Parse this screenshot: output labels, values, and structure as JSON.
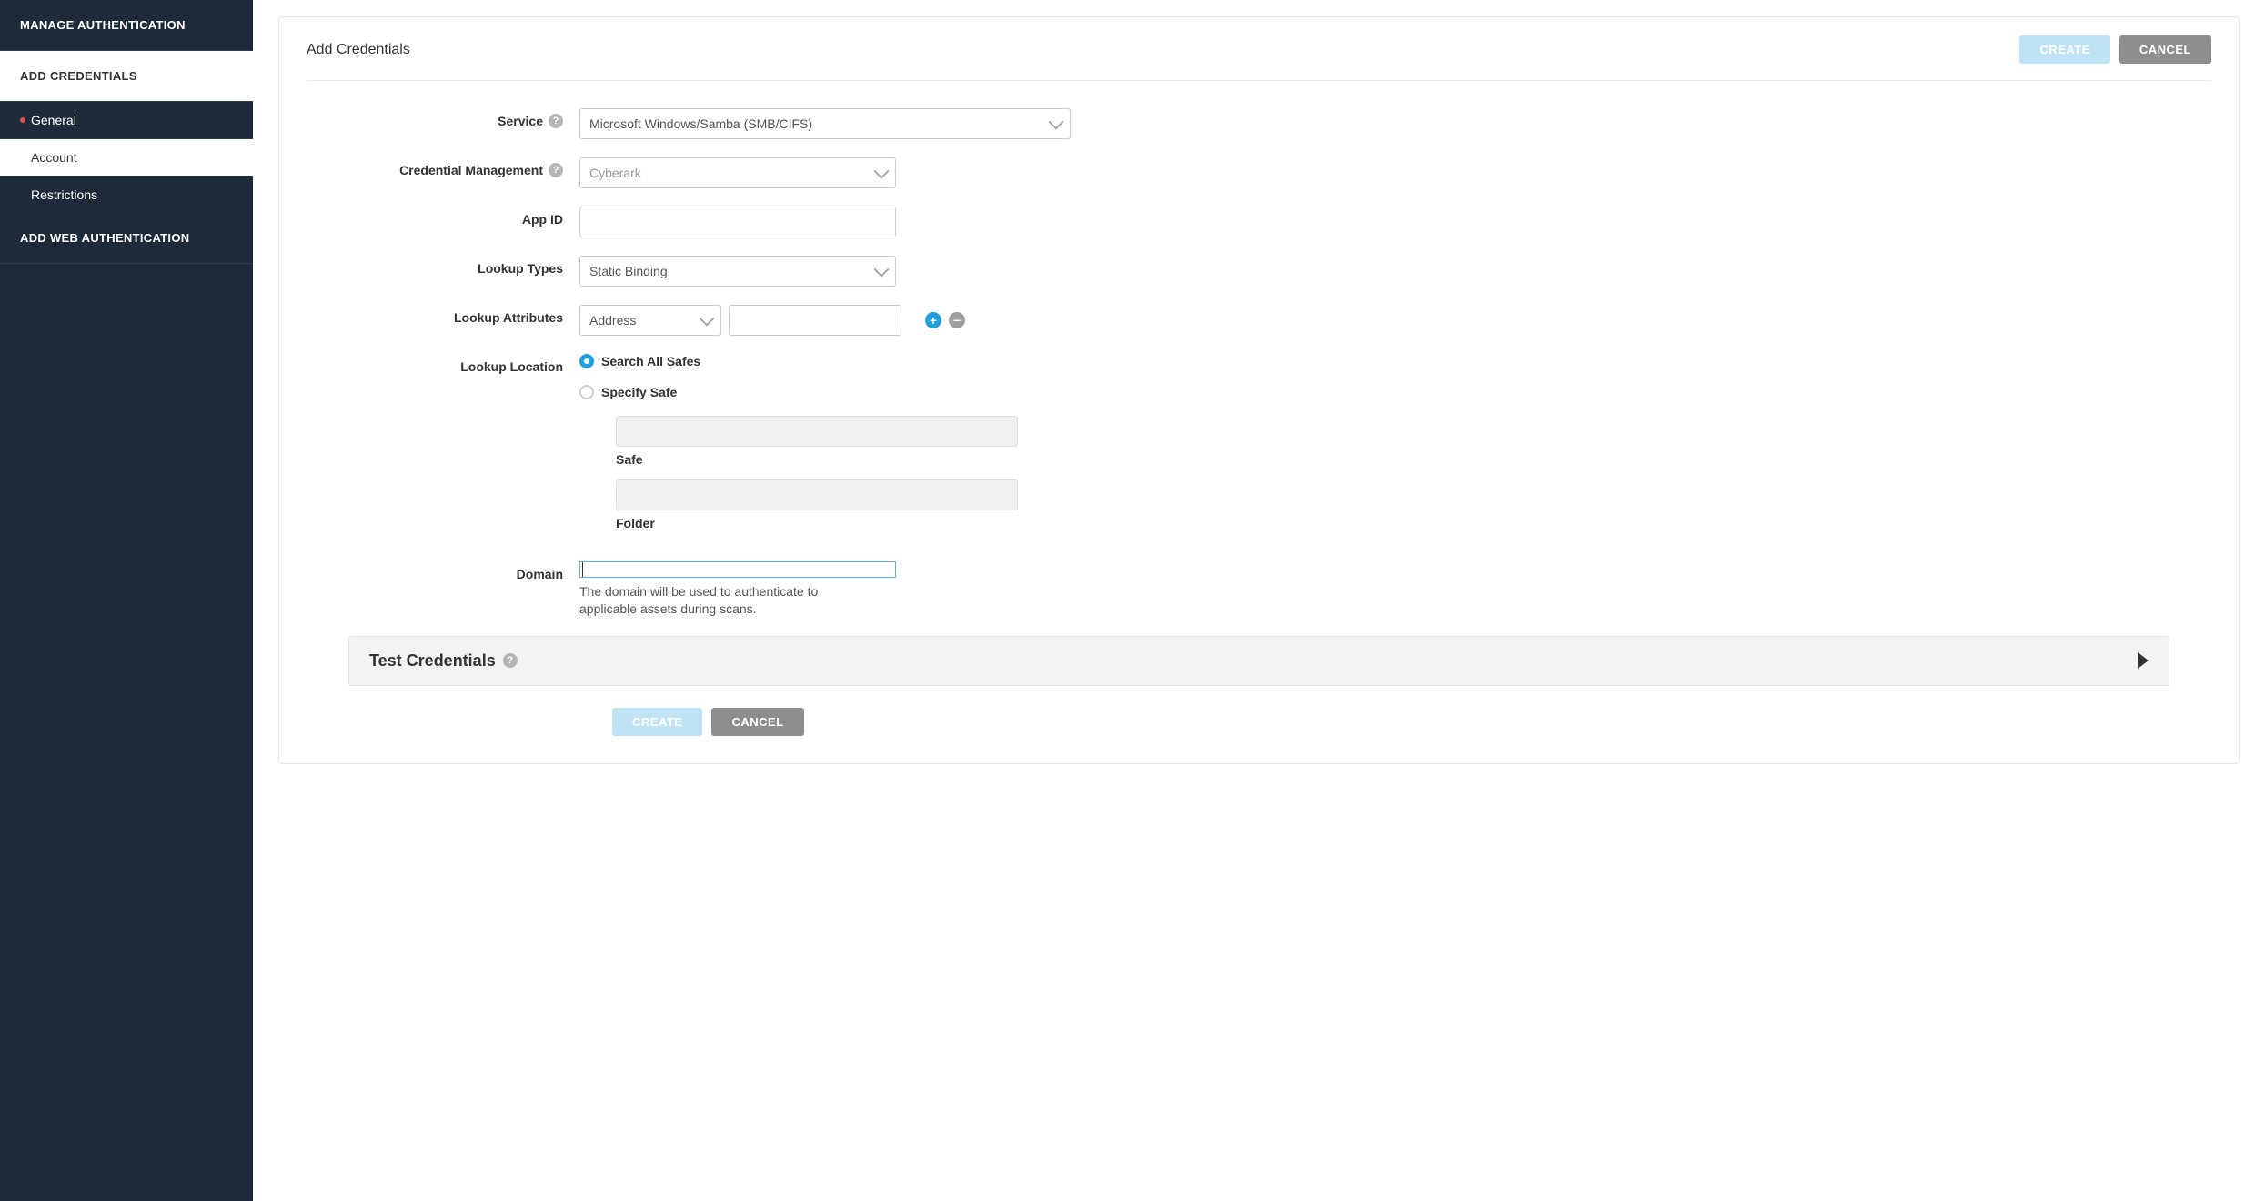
{
  "sidebar": {
    "heading_manage": "MANAGE AUTHENTICATION",
    "heading_add_creds": "ADD CREDENTIALS",
    "items": {
      "general": "General",
      "account": "Account",
      "restrictions": "Restrictions"
    },
    "heading_add_web": "ADD WEB AUTHENTICATION"
  },
  "panel": {
    "title": "Add Credentials",
    "create_label": "CREATE",
    "cancel_label": "CANCEL"
  },
  "form": {
    "service_label": "Service",
    "service_value": "Microsoft Windows/Samba (SMB/CIFS)",
    "cred_mgmt_label": "Credential Management",
    "cred_mgmt_value": "Cyberark",
    "appid_label": "App ID",
    "appid_value": "",
    "lookup_types_label": "Lookup Types",
    "lookup_types_value": "Static Binding",
    "lookup_attr_label": "Lookup Attributes",
    "lookup_attr_value": "Address",
    "lookup_attr_text": "",
    "lookup_loc_label": "Lookup Location",
    "radio_all": "Search All Safes",
    "radio_specify": "Specify Safe",
    "safe_label": "Safe",
    "folder_label": "Folder",
    "domain_label": "Domain",
    "domain_value": "",
    "domain_help": "The domain will be used to authenticate to applicable assets during scans."
  },
  "icons": {
    "help_glyph": "?",
    "plus_glyph": "+",
    "minus_glyph": "−"
  },
  "collapsible": {
    "title": "Test Credentials"
  },
  "bottom": {
    "create_label": "CREATE",
    "cancel_label": "CANCEL"
  }
}
